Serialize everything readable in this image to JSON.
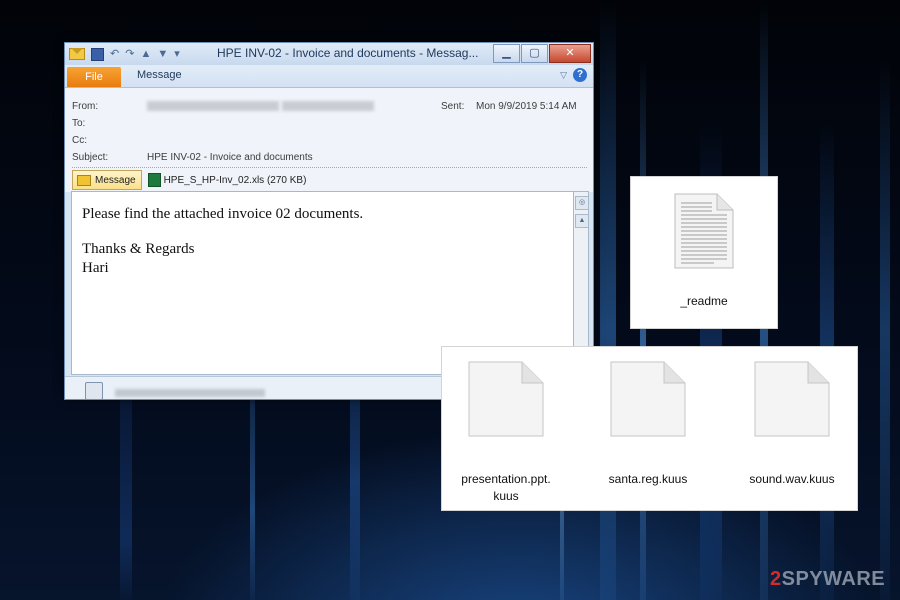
{
  "outlook": {
    "title": "HPE INV-02 - Invoice and documents - Messag...",
    "window_buttons": [
      "▁",
      "▢",
      "✕"
    ],
    "ribbon": {
      "file_tab": "File",
      "message_tab": "Message",
      "help": "?"
    },
    "header": {
      "from_label": "From:",
      "to_label": "To:",
      "cc_label": "Cc:",
      "subject_label": "Subject:",
      "subject_value": "HPE INV-02 - Invoice and documents",
      "sent_label": "Sent:",
      "sent_value": "Mon 9/9/2019 5:14 AM"
    },
    "attachments": {
      "message_chip": "Message",
      "file": "HPE_S_HP-Inv_02.xls (270 KB)"
    },
    "body_lines": [
      "Please find the attached invoice 02 documents.",
      "Thanks & Regards",
      "Hari"
    ]
  },
  "readme_file": {
    "name": "_readme",
    "icon": "text-document-icon"
  },
  "encrypted_files": [
    {
      "name_line1": "presentation.ppt.",
      "name_line2": "kuus",
      "icon": "blank-document-icon"
    },
    {
      "name_line1": "santa.reg.kuus",
      "icon": "blank-document-icon"
    },
    {
      "name_line1": "sound.wav.kuus",
      "icon": "blank-document-icon"
    }
  ],
  "watermark": {
    "number": "2",
    "text": "SPYWARE"
  },
  "colors": {
    "file_tab": "#e87c0e",
    "watermark_red": "#d12c2c"
  }
}
